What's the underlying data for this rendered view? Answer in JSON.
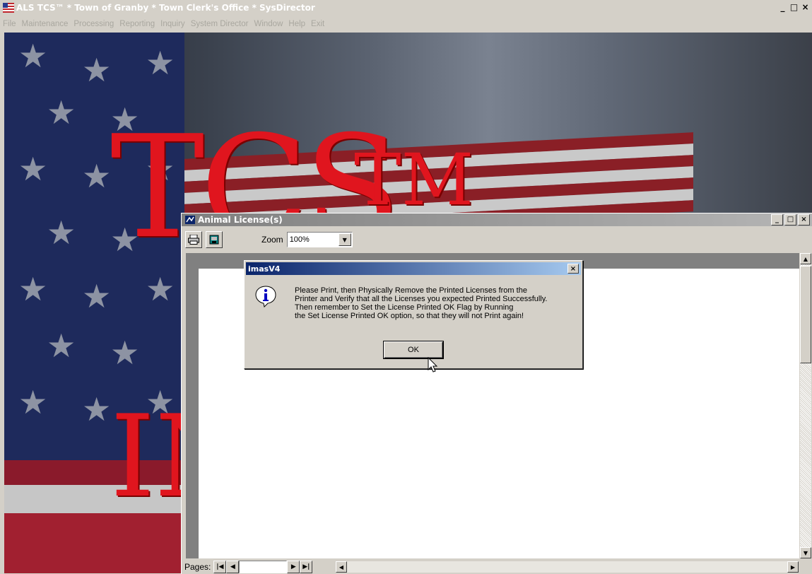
{
  "main_window": {
    "title": "ALS TCS™ * Town of Granby * Town Clerk's Office * SysDirector",
    "controls": [
      "_",
      "□",
      "×"
    ]
  },
  "menu": {
    "items": [
      "File",
      "Maintenance",
      "Processing",
      "Reporting",
      "Inquiry",
      "System Director",
      "Window",
      "Help",
      "Exit"
    ]
  },
  "background": {
    "logo_text": "TCS",
    "logo_tm": "TM",
    "logo_lower": "IN"
  },
  "report_window": {
    "title": "Animal License(s)",
    "zoom_label": "Zoom",
    "zoom_value": "100%",
    "pages_label": "Pages:"
  },
  "dialog": {
    "title": "imasV4",
    "message_lines": [
      "Please Print, then Physically Remove the Printed Licenses from the",
      "Printer and Verify that all the Licenses you expected Printed Successfully.",
      "Then remember to Set the License Printed OK Flag by Running",
      "the Set License Printed OK option, so that they will not Print again!"
    ],
    "ok_label": "OK",
    "close_glyph": "×"
  },
  "colors": {
    "dialog_title_gradient_start": "#0a246a",
    "dialog_title_gradient_end": "#a6caf0",
    "logo_red": "#e0151e",
    "window_face": "#d4d0c8",
    "menu_text_disabled": "#a9a79f"
  },
  "icons": {
    "app_icon": "flag-icon",
    "print": "printer-icon",
    "export": "export-icon",
    "info": "info-icon"
  }
}
